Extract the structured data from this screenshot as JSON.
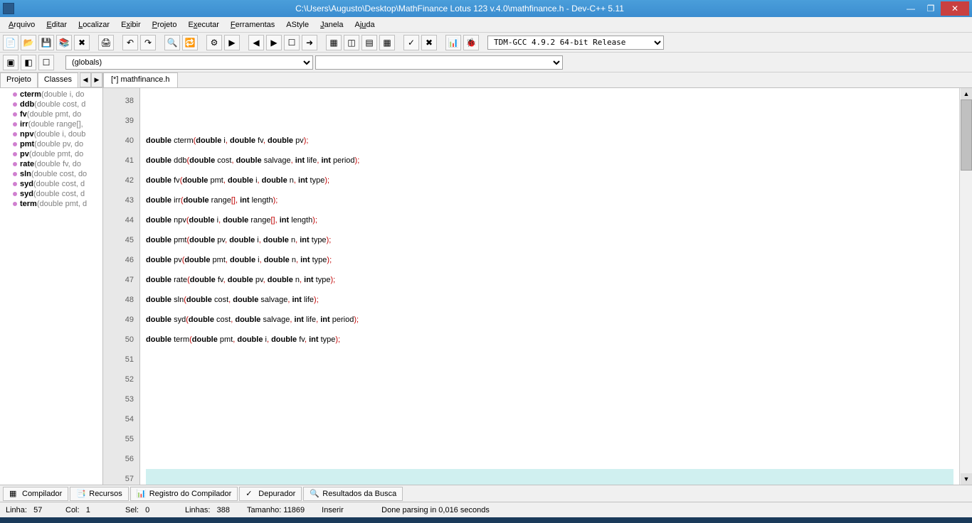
{
  "window": {
    "title": "C:\\Users\\Augusto\\Desktop\\MathFinance Lotus 123 v.4.0\\mathfinance.h - Dev-C++ 5.11"
  },
  "menu": {
    "items": [
      "Arquivo",
      "Editar",
      "Localizar",
      "Exibir",
      "Projeto",
      "Executar",
      "Ferramentas",
      "AStyle",
      "Janela",
      "Ajuda"
    ]
  },
  "toolbar": {
    "compiler_select": "TDM-GCC 4.9.2 64-bit Release"
  },
  "toolbar2": {
    "scope_select": "(globals)"
  },
  "sidebar": {
    "tabs": {
      "projeto": "Projeto",
      "classes": "Classes"
    },
    "items": [
      {
        "name": "cterm",
        "sig": " (double i, do"
      },
      {
        "name": "ddb",
        "sig": " (double cost, d"
      },
      {
        "name": "fv",
        "sig": " (double pmt, do"
      },
      {
        "name": "irr",
        "sig": " (double range[],"
      },
      {
        "name": "npv",
        "sig": " (double i, doub"
      },
      {
        "name": "pmt",
        "sig": " (double pv, do"
      },
      {
        "name": "pv",
        "sig": " (double pmt, do"
      },
      {
        "name": "rate",
        "sig": " (double fv, do"
      },
      {
        "name": "sln",
        "sig": " (double cost, do"
      },
      {
        "name": "syd",
        "sig": " (double cost, d"
      },
      {
        "name": "syd",
        "sig": " (double cost, d"
      },
      {
        "name": "term",
        "sig": " (double pmt, d"
      }
    ]
  },
  "editor": {
    "tab": "[*] mathfinance.h",
    "first_line": 38,
    "lines": [
      "",
      "",
      "double cterm(double i, double fv, double pv);",
      "double ddb(double cost, double salvage, int life, int period);",
      "double fv(double pmt, double i, double n, int type);",
      "double irr(double range[], int length);",
      "double npv(double i, double range[], int length);",
      "double pmt(double pv, double i, double n, int type);",
      "double pv(double pmt, double i, double n, int type);",
      "double rate(double fv, double pv, double n, int type);",
      "double sln(double cost, double salvage, int life);",
      "double syd(double cost, double salvage, int life, int period);",
      "double term(double pmt, double i, double fv, int type);",
      "",
      "",
      "",
      "",
      "",
      "",
      ""
    ]
  },
  "bottom_tabs": {
    "compilador": "Compilador",
    "recursos": "Recursos",
    "registro": "Registro do Compilador",
    "depurador": "Depurador",
    "resultados": "Resultados da Busca"
  },
  "status": {
    "linha_label": "Linha:",
    "linha": "57",
    "col_label": "Col:",
    "col": "1",
    "sel_label": "Sel:",
    "sel": "0",
    "linhas_label": "Linhas:",
    "linhas": "388",
    "tamanho_label": "Tamanho:",
    "tamanho": "11869",
    "mode": "Inserir",
    "parse": "Done parsing in 0,016 seconds"
  }
}
